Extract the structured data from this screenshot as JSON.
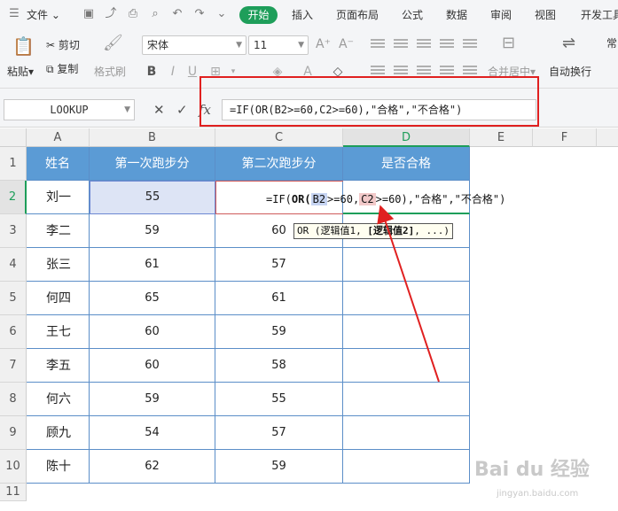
{
  "menu": {
    "file": "文件",
    "tabs": [
      "开始",
      "插入",
      "页面布局",
      "公式",
      "数据",
      "审阅",
      "视图",
      "开发工具"
    ]
  },
  "ribbon": {
    "paste": "粘贴",
    "cut": "剪切",
    "copy": "复制",
    "format_painter": "格式刷",
    "font_name": "宋体",
    "font_size": "11",
    "merge_center": "合并居中",
    "wrap_text": "自动换行",
    "overflow_label": "常"
  },
  "formula_bar": {
    "name_box": "LOOKUP",
    "fx": "fx",
    "formula": "=IF(OR(B2>=60,C2>=60),\"合格\",\"不合格\")"
  },
  "in_cell_formula": {
    "prefix": "=IF(",
    "or": "OR",
    "open": "(",
    "ref_b": "B2",
    "mid": ">=60,",
    "ref_c": "C2",
    "suffix": ">=60),\"合格\",\"不合格\")"
  },
  "tooltip": {
    "prefix": "OR (逻辑值1, ",
    "bold": "[逻辑值2]",
    "suffix": ", ...)"
  },
  "grid": {
    "columns": [
      "A",
      "B",
      "C",
      "D",
      "E",
      "F"
    ],
    "rows": [
      "1",
      "2",
      "3",
      "4",
      "5",
      "6",
      "7",
      "8",
      "9",
      "10",
      "11"
    ],
    "headers": [
      "姓名",
      "第一次跑步分",
      "第二次跑步分",
      "是否合格"
    ],
    "data": [
      [
        "刘一",
        "55",
        ""
      ],
      [
        "李二",
        "59",
        "60"
      ],
      [
        "张三",
        "61",
        "57"
      ],
      [
        "何四",
        "65",
        "61"
      ],
      [
        "王七",
        "60",
        "59"
      ],
      [
        "李五",
        "60",
        "58"
      ],
      [
        "何六",
        "59",
        "55"
      ],
      [
        "顾九",
        "54",
        "57"
      ],
      [
        "陈十",
        "62",
        "59"
      ]
    ]
  },
  "watermark": {
    "main": "Bai du 经验",
    "sub": "jingyan.baidu.com"
  },
  "colors": {
    "accent_green": "#1e9e5a",
    "header_blue": "#5b9bd5",
    "annotation_red": "#e02020"
  }
}
